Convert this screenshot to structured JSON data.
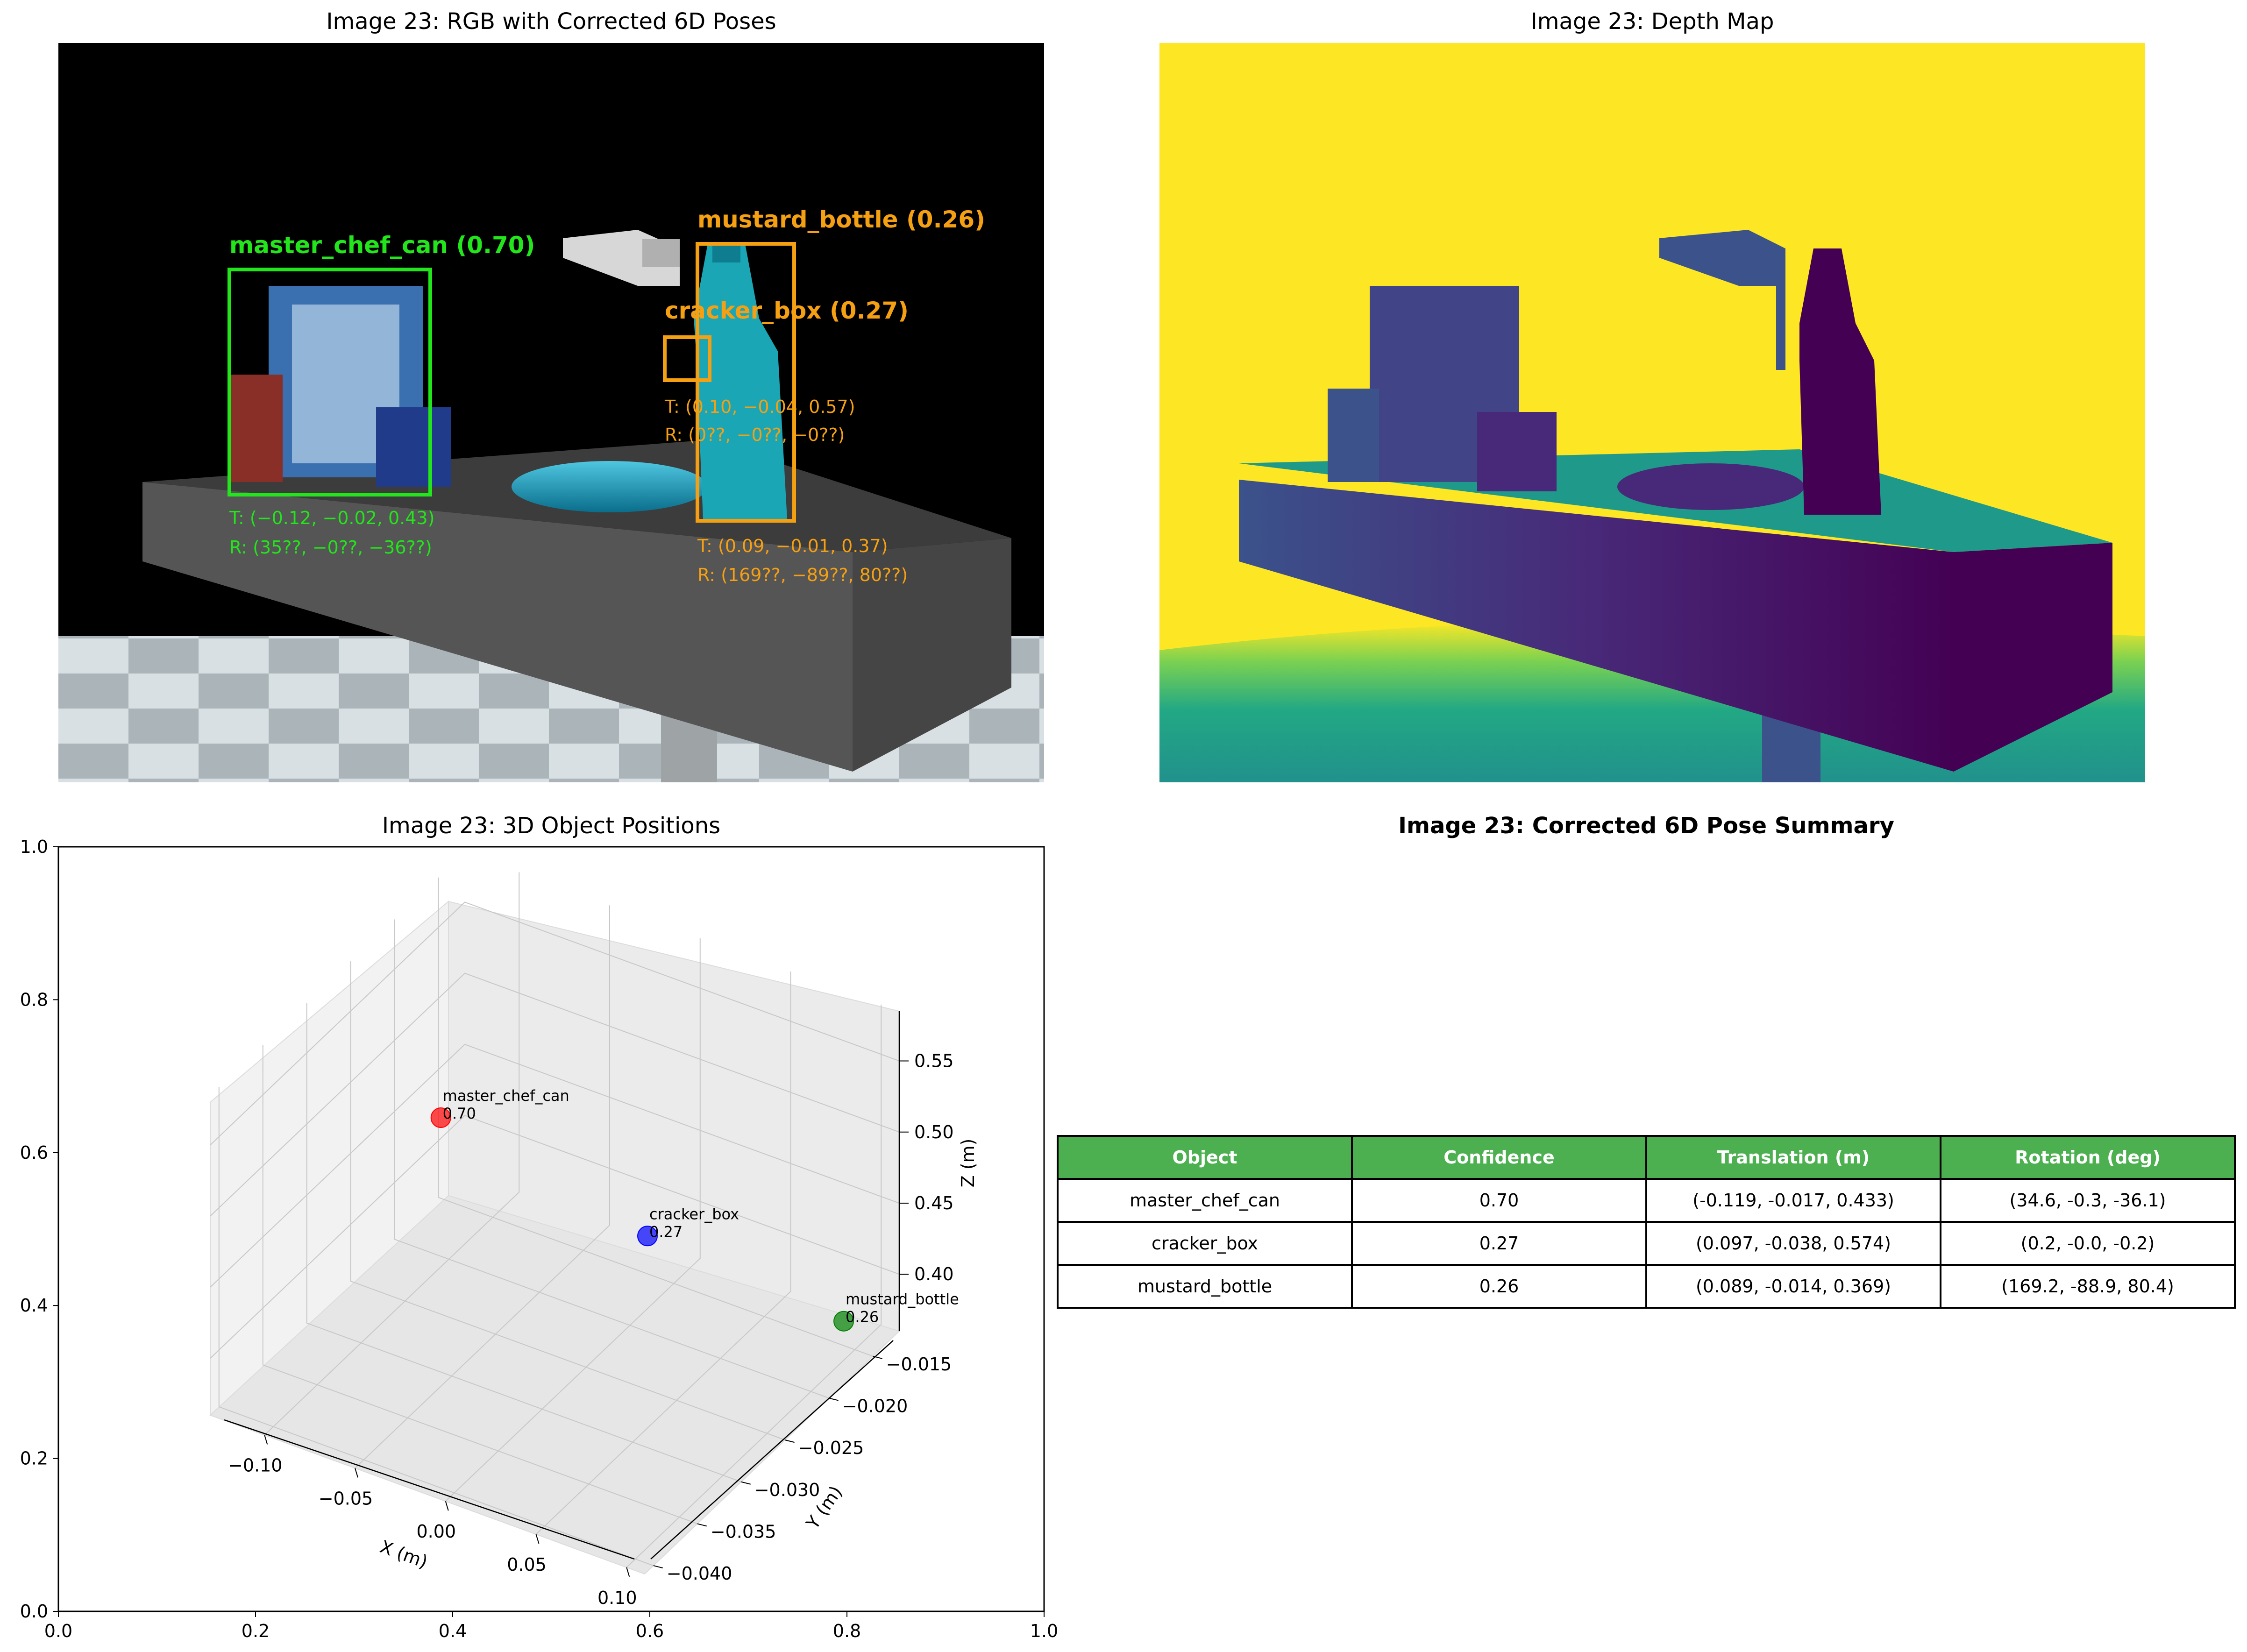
{
  "titles": {
    "rgb": "Image 23: RGB with Corrected 6D Poses",
    "depth": "Image 23: Depth Map",
    "positions": "Image 23: 3D Object Positions",
    "summary": "Image 23: Corrected 6D Pose Summary"
  },
  "rgb_annotations": {
    "master_chef_can": {
      "label": "master_chef_can (0.70)",
      "translation": "T: (−0.12, −0.02, 0.43)",
      "rotation": "R: (35??, −0??, −36??)",
      "color": "#22e51b"
    },
    "cracker_box": {
      "label": "cracker_box (0.27)",
      "translation": "T: (0.10, −0.04, 0.57)",
      "rotation": "R: (0??, −0??, −0??)",
      "color": "#f5a012"
    },
    "mustard_bottle": {
      "label": "mustard_bottle (0.26)",
      "translation": "T: (0.09, −0.01, 0.37)",
      "rotation": "R: (169??, −89??, 80??)",
      "color": "#f5a012"
    }
  },
  "colors": {
    "depth_far": "#fde725",
    "depth_near": "#440154",
    "header_green": "#4caf50"
  },
  "chart_data": [
    {
      "type": "scatter",
      "projection": "3d",
      "title": "Image 23: 3D Object Positions",
      "xlabel": "X (m)",
      "ylabel": "Y (m)",
      "zlabel": "Z (m)",
      "xticks": [
        "−0.10",
        "−0.05",
        "0.00",
        "0.05",
        "0.10"
      ],
      "yticks": [
        "−0.040",
        "−0.035",
        "−0.030",
        "−0.025",
        "−0.020",
        "−0.015"
      ],
      "zticks": [
        "0.40",
        "0.45",
        "0.50",
        "0.55"
      ],
      "xlim": [
        -0.13,
        0.11
      ],
      "ylim": [
        -0.041,
        -0.012
      ],
      "zlim": [
        0.36,
        0.585
      ],
      "points": [
        {
          "name": "master_chef_can",
          "conf": "0.70",
          "x": -0.119,
          "y": -0.017,
          "z": 0.433,
          "color": "#ff0000"
        },
        {
          "name": "cracker_box",
          "conf": "0.27",
          "x": 0.097,
          "y": -0.038,
          "z": 0.574,
          "color": "#0000ff"
        },
        {
          "name": "mustard_bottle",
          "conf": "0.26",
          "x": 0.089,
          "y": -0.014,
          "z": 0.369,
          "color": "#008000"
        }
      ],
      "background_axes": {
        "xticks": [
          "0.0",
          "0.2",
          "0.4",
          "0.6",
          "0.8",
          "1.0"
        ],
        "yticks": [
          "0.0",
          "0.2",
          "0.4",
          "0.6",
          "0.8",
          "1.0"
        ],
        "xlim": [
          0,
          1
        ],
        "ylim": [
          0,
          1
        ]
      }
    },
    {
      "type": "table",
      "title": "Image 23: Corrected 6D Pose Summary",
      "columns": [
        "Object",
        "Confidence",
        "Translation (m)",
        "Rotation (deg)"
      ],
      "rows": [
        [
          "master_chef_can",
          "0.70",
          "(-0.119, -0.017, 0.433)",
          "(34.6, -0.3, -36.1)"
        ],
        [
          "cracker_box",
          "0.27",
          "(0.097, -0.038, 0.574)",
          "(0.2, -0.0, -0.2)"
        ],
        [
          "mustard_bottle",
          "0.26",
          "(0.089, -0.014, 0.369)",
          "(169.2, -88.9, 80.4)"
        ]
      ]
    }
  ]
}
